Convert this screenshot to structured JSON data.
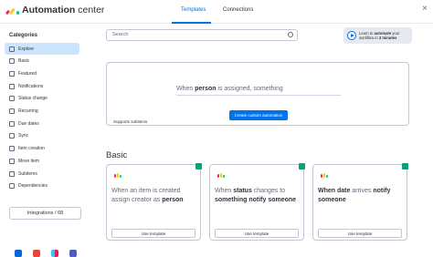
{
  "header": {
    "title_bold": "Automation",
    "title_rest": " center",
    "tabs": [
      "Templates",
      "Connections"
    ],
    "close_symbol": "×"
  },
  "sidebar": {
    "title": "Categories",
    "items": [
      {
        "label": "Explore",
        "icon": "compass-icon"
      },
      {
        "label": "Basic",
        "icon": "basic-icon"
      },
      {
        "label": "Featured",
        "icon": "star-icon"
      },
      {
        "label": "Notifications",
        "icon": "bell-icon"
      },
      {
        "label": "Status change",
        "icon": "status-icon"
      },
      {
        "label": "Recurring",
        "icon": "recurring-icon"
      },
      {
        "label": "Due dates",
        "icon": "calendar-icon"
      },
      {
        "label": "Sync",
        "icon": "sync-icon"
      },
      {
        "label": "Item creation",
        "icon": "plus-icon"
      },
      {
        "label": "Move item",
        "icon": "move-icon"
      },
      {
        "label": "Subitems",
        "icon": "subitems-icon"
      },
      {
        "label": "Dependencies",
        "icon": "dependencies-icon"
      }
    ],
    "integrations_label": "Integrations / 68",
    "app_logos": [
      "outlook",
      "gmail",
      "slack",
      "teams"
    ]
  },
  "search": {
    "placeholder": "Search"
  },
  "promo": {
    "l1": "Learn to ",
    "l1b": "automate",
    "l1c": " your",
    "l2": "workflow in ",
    "l2b": "3 minutes"
  },
  "builder": {
    "w1": "When ",
    "w2": "person",
    "w3": " is assigned, ",
    "w4": "something",
    "create_label": "Create custom automation",
    "supports_label": "Supports subitems"
  },
  "section_title": "Basic",
  "cards": [
    {
      "parts": [
        [
          "When an item is created ",
          false
        ],
        [
          "assign creator as ",
          false
        ],
        [
          "person",
          true
        ]
      ],
      "button": "Use template"
    },
    {
      "parts": [
        [
          "When ",
          false
        ],
        [
          "status",
          true
        ],
        [
          " changes to ",
          false
        ],
        [
          "something notify someone",
          true
        ]
      ],
      "button": "Use template"
    },
    {
      "parts": [
        [
          "When ",
          true
        ],
        [
          "date",
          true
        ],
        [
          " arrives ",
          false
        ],
        [
          "notify someone",
          true
        ]
      ],
      "button": "Use template"
    }
  ],
  "colors": {
    "accent": "#0073ea",
    "active_bg": "#cce5ff",
    "badge": "#00a57a"
  }
}
